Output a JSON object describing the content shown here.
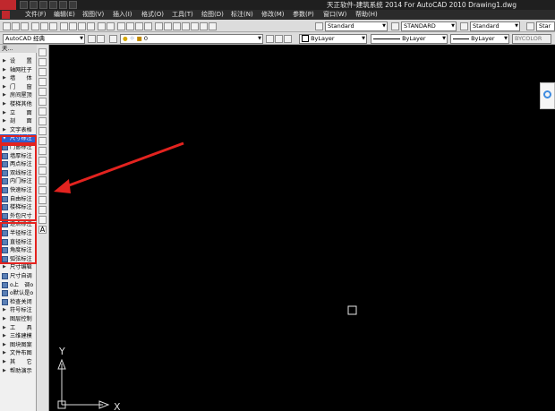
{
  "window": {
    "title": "天正软件-建筑系统 2014  For AutoCAD 2010     Drawing1.dwg"
  },
  "menu": {
    "items": [
      "文件(F)",
      "编辑(E)",
      "视图(V)",
      "插入(I)",
      "格式(O)",
      "工具(T)",
      "绘图(D)",
      "标注(N)",
      "修改(M)",
      "参数(P)",
      "窗口(W)",
      "帮助(H)"
    ]
  },
  "toolbar": {
    "text_style": "Standard",
    "dim_style": "STANDARD",
    "table_style": "Standard",
    "multileader_style": "Star",
    "workspace": "AutoCAD 经典",
    "layer": "0",
    "color": "ByLayer",
    "linetype": "ByLayer",
    "lineweight": "ByLayer",
    "plotstyle": "BYCOLOR"
  },
  "left_panel": {
    "header": "天...",
    "items": [
      {
        "label": "设　　置",
        "kind": "group"
      },
      {
        "label": "轴网柱子",
        "kind": "group"
      },
      {
        "label": "墙　　体",
        "kind": "group"
      },
      {
        "label": "门　　窗",
        "kind": "group"
      },
      {
        "label": "房间屋顶",
        "kind": "group"
      },
      {
        "label": "楼梯其他",
        "kind": "group"
      },
      {
        "label": "立　　面",
        "kind": "group"
      },
      {
        "label": "剖　　面",
        "kind": "group"
      },
      {
        "label": "文字表格",
        "kind": "group"
      },
      {
        "label": "尺寸标注",
        "kind": "group-open"
      },
      {
        "label": "门窗标注",
        "kind": "cmd"
      },
      {
        "label": "墙厚标注",
        "kind": "cmd"
      },
      {
        "label": "两点标注",
        "kind": "cmd"
      },
      {
        "label": "双线标注",
        "kind": "cmd"
      },
      {
        "label": "内门标注",
        "kind": "cmd"
      },
      {
        "label": "快速标注",
        "kind": "cmd"
      },
      {
        "label": "自由标注",
        "kind": "cmd"
      },
      {
        "label": "楼梯标注",
        "kind": "cmd"
      },
      {
        "label": "外包尺寸",
        "kind": "cmd"
      },
      {
        "label": "逐点标注",
        "kind": "cmd"
      },
      {
        "label": "半径标注",
        "kind": "cmd"
      },
      {
        "label": "直径标注",
        "kind": "cmd"
      },
      {
        "label": "角度标注",
        "kind": "cmd"
      },
      {
        "label": "弧弦标注",
        "kind": "cmd"
      },
      {
        "label": "尺寸编辑",
        "kind": "group"
      },
      {
        "label": "尺寸自调",
        "kind": "cmd"
      },
      {
        "label": "o上　调o",
        "kind": "cmd"
      },
      {
        "label": "o默认是o",
        "kind": "cmd"
      },
      {
        "label": "检查关闭",
        "kind": "cmd"
      },
      {
        "label": "符号标注",
        "kind": "group"
      },
      {
        "label": "图层控制",
        "kind": "group"
      },
      {
        "label": "工　　具",
        "kind": "group"
      },
      {
        "label": "三维建模",
        "kind": "group"
      },
      {
        "label": "图块图案",
        "kind": "group"
      },
      {
        "label": "文件布图",
        "kind": "group"
      },
      {
        "label": "其　　它",
        "kind": "group"
      },
      {
        "label": "帮助演示",
        "kind": "group"
      }
    ]
  },
  "canvas": {
    "ucs_y_label": "Y",
    "ucs_x_label": "X",
    "background": "#000000",
    "annotation_color": "#e3231f"
  }
}
